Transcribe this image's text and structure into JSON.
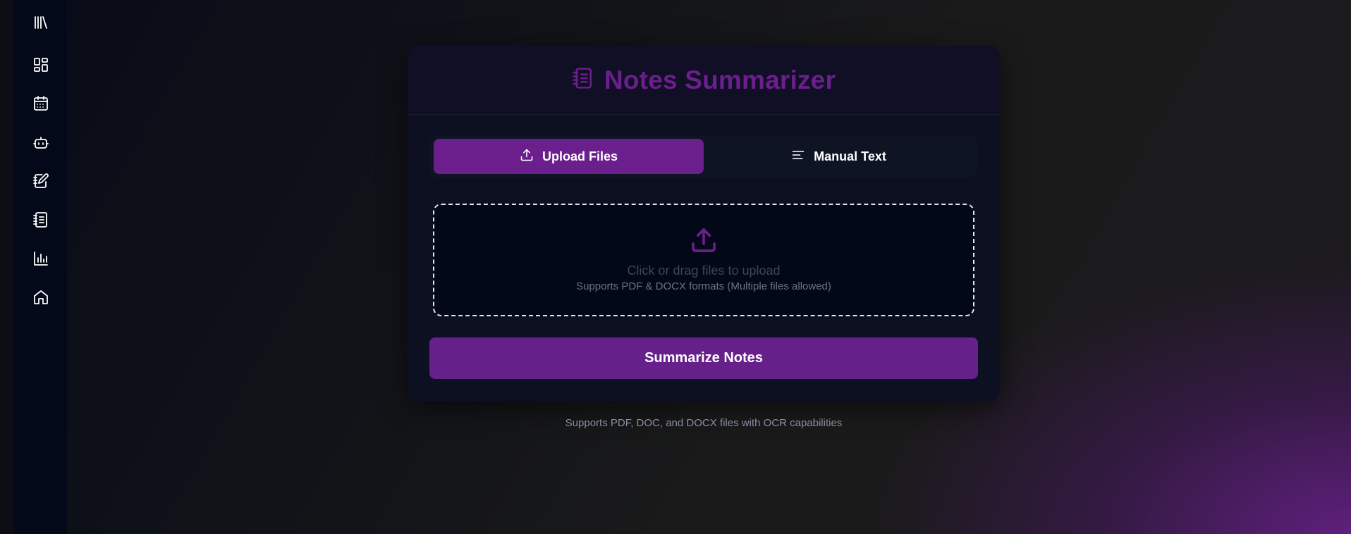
{
  "sidebar": {
    "logo_icon": "library-icon",
    "items": [
      {
        "icon": "dashboard-icon"
      },
      {
        "icon": "calendar-icon"
      },
      {
        "icon": "bot-icon"
      },
      {
        "icon": "notebook-pen-icon"
      },
      {
        "icon": "notebook-text-icon"
      },
      {
        "icon": "bar-chart-icon"
      },
      {
        "icon": "home-icon"
      }
    ]
  },
  "card": {
    "title": "Notes Summarizer",
    "title_icon": "notebook-text-icon",
    "tabs": [
      {
        "label": "Upload Files",
        "icon": "upload-icon",
        "active": true
      },
      {
        "label": "Manual Text",
        "icon": "text-align-left-icon",
        "active": false
      }
    ],
    "dropzone": {
      "icon": "upload-icon",
      "main_text": "Click or drag files to upload",
      "sub_text": "Supports PDF & DOCX formats (Multiple files allowed)"
    },
    "submit_label": "Summarize Notes"
  },
  "footer_note": "Supports PDF, DOC, and DOCX files with OCR capabilities",
  "colors": {
    "accent": "#6b1f8c",
    "button": "#66208a",
    "sidebar_bg": "#030918",
    "card_bg": "#0c1020"
  }
}
